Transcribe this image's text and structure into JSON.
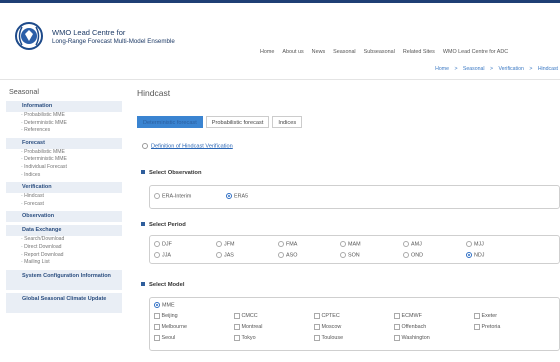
{
  "header": {
    "title_line1": "WMO Lead Centre for",
    "title_line2": "Long-Range Forecast Multi-Model Ensemble",
    "nav": [
      "Home",
      "About us",
      "News",
      "Seasonal",
      "Subseasonal",
      "Related Sites",
      "WMO Lead Centre for ADC"
    ],
    "breadcrumb": [
      "Home",
      ">",
      "Seasonal",
      ">",
      "Verification",
      ">",
      "Hindcast"
    ]
  },
  "sidebar": {
    "title": "Seasonal",
    "sections": [
      {
        "label": "Information",
        "items": [
          "Probabilistic MME",
          "Deterministic MME",
          "References"
        ]
      },
      {
        "label": "Forecast",
        "items": [
          "Probabilistic MME",
          "Deterministic MME",
          "Individual Forecast",
          "Indices"
        ]
      },
      {
        "label": "Verification",
        "items": [
          "Hindcast",
          "Forecast"
        ]
      },
      {
        "label": "Observation",
        "items": []
      },
      {
        "label": "Data Exchange",
        "items": [
          "Search/Download",
          "Direct Download",
          "Report Download",
          "Mailing List"
        ]
      },
      {
        "label": "System Configuration Information",
        "items": []
      },
      {
        "label": "Global Seasonal Climate Update",
        "items": []
      }
    ]
  },
  "main": {
    "title": "Hindcast",
    "tabs": [
      "Deterministic forecast",
      "Probabilistic forecast",
      "Indices"
    ],
    "definition_link": "Definition of Hindcast Verification",
    "observation": {
      "label": "Select Observation",
      "options": [
        "ERA-Interim",
        "ERA5"
      ],
      "selected": "ERA5"
    },
    "period": {
      "label": "Select Period",
      "options": [
        "DJF",
        "JFM",
        "FMA",
        "MAM",
        "AMJ",
        "MJJ",
        "JJA",
        "JAS",
        "ASO",
        "SON",
        "OND",
        "NDJ"
      ],
      "selected": "NDJ"
    },
    "model": {
      "label": "Select Model",
      "mme": "MME",
      "options": [
        "Beijing",
        "CMCC",
        "CPTEC",
        "ECMWF",
        "Exeter",
        "Melbourne",
        "Montreal",
        "Moscow",
        "Offenbach",
        "Pretoria",
        "Seoul",
        "Tokyo",
        "Toulouse",
        "Washington"
      ]
    }
  },
  "colors": {
    "brand": "#1d3a66",
    "accent": "#3a84d1",
    "sidebar_head_bg": "#e9eef5"
  }
}
